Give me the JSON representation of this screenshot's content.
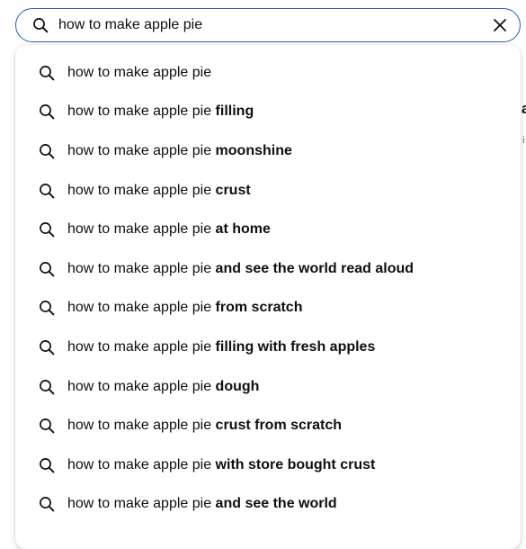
{
  "search": {
    "value": "how to make apple pie",
    "icon": "search-icon",
    "clear_icon": "close-icon"
  },
  "suggestions": [
    {
      "prefix": "how to make apple pie",
      "completion": ""
    },
    {
      "prefix": "how to make apple pie",
      "completion": " filling"
    },
    {
      "prefix": "how to make apple pie",
      "completion": " moonshine"
    },
    {
      "prefix": "how to make apple pie",
      "completion": " crust"
    },
    {
      "prefix": "how to make apple pie",
      "completion": " at home"
    },
    {
      "prefix": "how to make apple pie",
      "completion": " and see the world read aloud"
    },
    {
      "prefix": "how to make apple pie",
      "completion": " from scratch"
    },
    {
      "prefix": "how to make apple pie",
      "completion": " filling with fresh apples"
    },
    {
      "prefix": "how to make apple pie",
      "completion": " dough"
    },
    {
      "prefix": "how to make apple pie",
      "completion": " crust from scratch"
    },
    {
      "prefix": "how to make apple pie",
      "completion": " with store bought crust"
    },
    {
      "prefix": "how to make apple pie",
      "completion": " and see the world"
    }
  ],
  "background": {
    "fragment_1": "a",
    "fragment_2": "i"
  },
  "colors": {
    "focus_border": "#1c62b9",
    "text": "#0f0f0f"
  }
}
